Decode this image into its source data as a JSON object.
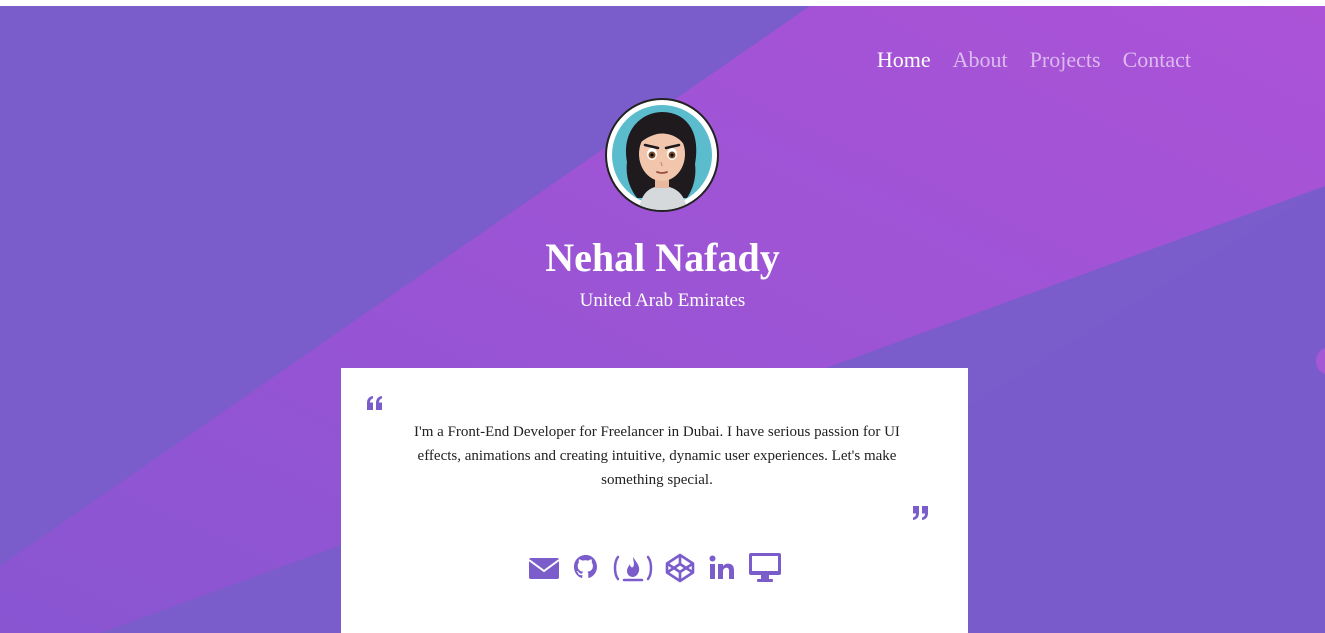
{
  "nav": {
    "items": [
      {
        "label": "Home",
        "active": true
      },
      {
        "label": "About",
        "active": false
      },
      {
        "label": "Projects",
        "active": false
      },
      {
        "label": "Contact",
        "active": false
      }
    ]
  },
  "profile": {
    "name": "Nehal Nafady",
    "location": "United Arab Emirates",
    "avatar_icon": "cartoon-avatar"
  },
  "bio": {
    "text": "I'm a Front-End Developer for Freelancer in Dubai. I have serious passion for UI effects, animations and creating intuitive, dynamic user experiences. Let's make something special.",
    "open_quote_icon": "quote-left-icon",
    "close_quote_icon": "quote-right-icon"
  },
  "socials": [
    {
      "icon": "envelope-icon"
    },
    {
      "icon": "github-icon"
    },
    {
      "icon": "freecodecamp-icon"
    },
    {
      "icon": "codepen-icon"
    },
    {
      "icon": "linkedin-icon"
    },
    {
      "icon": "desktop-icon"
    }
  ],
  "colors": {
    "accent": "#7b5ccb",
    "gradient_light": "#a452d6",
    "text": "#222222"
  }
}
